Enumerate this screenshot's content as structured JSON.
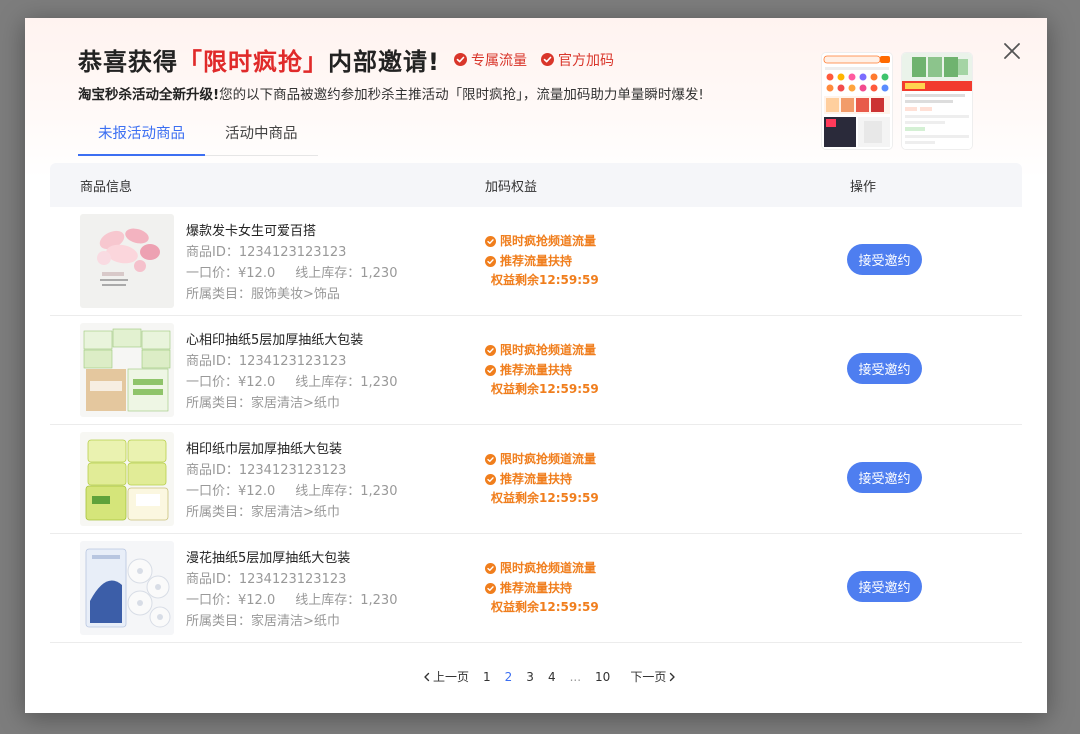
{
  "header": {
    "title_prefix": "恭喜获得",
    "title_highlight": "「限时疯抢」",
    "title_suffix": "内部邀请!",
    "tags": [
      "专属流量",
      "官方加码"
    ],
    "subtitle_bold": "淘宝秒杀活动全新升级!",
    "subtitle_text": "您的以下商品被邀约参加秒杀主推活动「限时疯抢」，流量加码助力单量瞬时爆发!"
  },
  "tabs": [
    {
      "label": "未报活动商品",
      "active": true
    },
    {
      "label": "活动中商品",
      "active": false
    }
  ],
  "table": {
    "columns": [
      "商品信息",
      "加码权益",
      "操作"
    ],
    "rows": [
      {
        "name": "爆款发卡女生可爱百搭",
        "id_label": "商品ID：",
        "id": "1234123123123",
        "price_label": "一口价：",
        "price": "¥12.0",
        "stock_label": "线上库存：",
        "stock": "1,230",
        "category_label": "所属类目：",
        "category": "服饰美妆>饰品",
        "image": "hair-clips",
        "benefits": [
          "限时疯抢频道流量",
          "推荐流量扶持"
        ],
        "timer": "权益剩余12:59:59",
        "action": "接受邀约"
      },
      {
        "name": "心相印抽纸5层加厚抽纸大包装",
        "id_label": "商品ID：",
        "id": "1234123123123",
        "price_label": "一口价：",
        "price": "¥12.0",
        "stock_label": "线上库存：",
        "stock": "1,230",
        "category_label": "所属类目：",
        "category": "家居清洁>纸巾",
        "image": "tissue-boxes",
        "benefits": [
          "限时疯抢频道流量",
          "推荐流量扶持"
        ],
        "timer": "权益剩余12:59:59",
        "action": "接受邀约"
      },
      {
        "name": "相印纸巾层加厚抽纸大包装",
        "id_label": "商品ID：",
        "id": "1234123123123",
        "price_label": "一口价：",
        "price": "¥12.0",
        "stock_label": "线上库存：",
        "stock": "1,230",
        "category_label": "所属类目：",
        "category": "家居清洁>纸巾",
        "image": "tissue-packs",
        "benefits": [
          "限时疯抢频道流量",
          "推荐流量扶持"
        ],
        "timer": "权益剩余12:59:59",
        "action": "接受邀约"
      },
      {
        "name": "漫花抽纸5层加厚抽纸大包装",
        "id_label": "商品ID：",
        "id": "1234123123123",
        "price_label": "一口价：",
        "price": "¥12.0",
        "stock_label": "线上库存：",
        "stock": "1,230",
        "category_label": "所属类目：",
        "category": "家居清洁>纸巾",
        "image": "toilet-rolls",
        "benefits": [
          "限时疯抢频道流量",
          "推荐流量扶持"
        ],
        "timer": "权益剩余12:59:59",
        "action": "接受邀约"
      }
    ]
  },
  "pagination": {
    "prev": "上一页",
    "pages": [
      "1",
      "2",
      "3",
      "4"
    ],
    "current": "2",
    "ellipsis": "...",
    "last": "10",
    "next": "下一页"
  },
  "colors": {
    "accent": "#3c6ff2",
    "button": "#4e7ef0",
    "highlight": "#e02a2a",
    "benefit": "#f07e1d"
  }
}
